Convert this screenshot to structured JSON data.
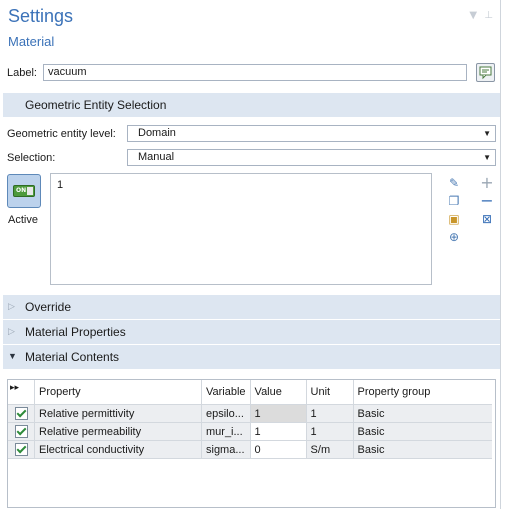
{
  "header": {
    "title": "Settings",
    "subtitle": "Material"
  },
  "label_field": {
    "label": "Label:",
    "value": "vacuum"
  },
  "sections": {
    "geometric": "Geometric Entity Selection",
    "override": "Override",
    "material_properties": "Material Properties",
    "material_contents": "Material Contents"
  },
  "geometric": {
    "level_label": "Geometric entity level:",
    "level_value": "Domain",
    "selection_label": "Selection:",
    "selection_value": "Manual",
    "active_label": "Active",
    "toggle_text": "ON",
    "selected_items": [
      "1"
    ]
  },
  "table": {
    "columns": [
      "Property",
      "Variable",
      "Value",
      "Unit",
      "Property group"
    ],
    "rows": [
      {
        "property": "Relative permittivity",
        "variable": "epsilo...",
        "value": "1",
        "unit": "1",
        "group": "Basic"
      },
      {
        "property": "Relative permeability",
        "variable": "mur_i...",
        "value": "1",
        "unit": "1",
        "group": "Basic"
      },
      {
        "property": "Electrical conductivity",
        "variable": "sigma...",
        "value": "0",
        "unit": "S/m",
        "group": "Basic"
      }
    ]
  },
  "colors": {
    "accent": "#3b72b8",
    "section_bg": "#dde6f1",
    "check": "#2e8b3a"
  }
}
